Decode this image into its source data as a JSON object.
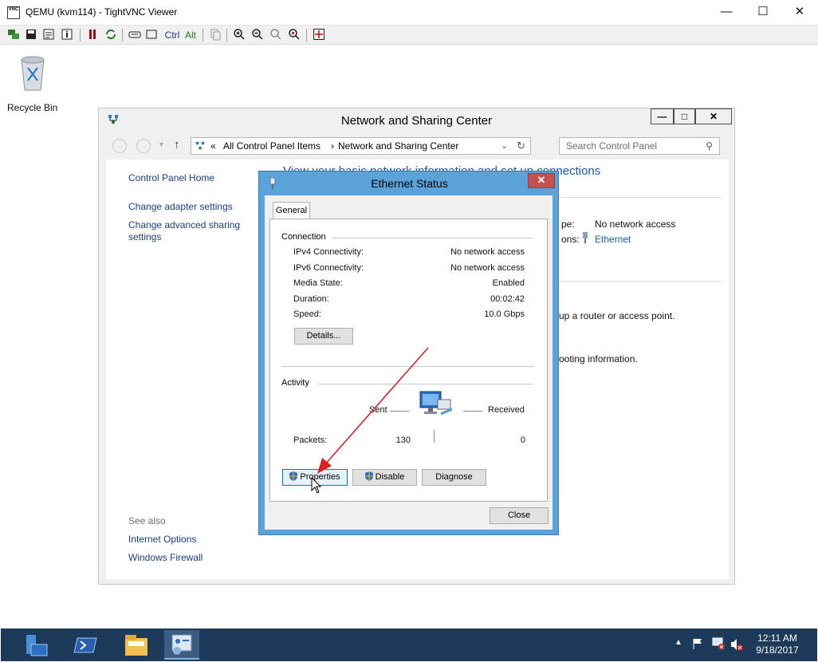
{
  "viewer": {
    "title": "QEMU (kvm114) - TightVNC Viewer",
    "icon_label": "VNC",
    "controls": {
      "minimize": "—",
      "maximize": "☐",
      "close": "✕"
    },
    "toolbar": {
      "ctrl_label": "Ctrl",
      "alt_label": "Alt"
    }
  },
  "desktop": {
    "recycle_bin_label": "Recycle Bin"
  },
  "ncs": {
    "title": "Network and Sharing Center",
    "address": {
      "chevrons": "«",
      "crumb1": "All Control Panel Items",
      "sep": "›",
      "crumb2": "Network and Sharing Center"
    },
    "search_placeholder": "Search Control Panel",
    "sidebar": {
      "home": "Control Panel Home",
      "adapter": "Change adapter settings",
      "sharing_line1": "Change advanced sharing",
      "sharing_line2": "settings",
      "see_also": "See also",
      "internet_options": "Internet Options",
      "firewall": "Windows Firewall"
    },
    "main": {
      "heading": "View your basic network information and set up connections",
      "access_type_suffix": "pe:",
      "access_value": "No network access",
      "connections_suffix": "ons:",
      "connection_link": "Ethernet",
      "router_text": "up a router or access point.",
      "troubleshoot_text": "ooting information."
    }
  },
  "dialog": {
    "title": "Ethernet Status",
    "close": "✕",
    "tab": "General",
    "connection_group": "Connection",
    "rows": [
      {
        "label": "IPv4 Connectivity:",
        "value": "No network access"
      },
      {
        "label": "IPv6 Connectivity:",
        "value": "No network access"
      },
      {
        "label": "Media State:",
        "value": "Enabled"
      },
      {
        "label": "Duration:",
        "value": "00:02:42"
      },
      {
        "label": "Speed:",
        "value": "10.0 Gbps"
      }
    ],
    "details_button": "Details...",
    "activity_group": "Activity",
    "sent_label": "Sent",
    "received_label": "Received",
    "packets_label": "Packets:",
    "packets_sent": "130",
    "packets_received": "0",
    "properties_button": "Properties",
    "disable_button": "Disable",
    "diagnose_button": "Diagnose",
    "close_button": "Close"
  },
  "taskbar": {
    "time": "12:11 AM",
    "date": "9/18/2017"
  },
  "colors": {
    "dialog_frame": "#5aa2d8",
    "close_red": "#c75050",
    "link_blue": "#1a3d8f",
    "taskbar": "#1e3a5a",
    "annotation_arrow": "#e02020"
  }
}
